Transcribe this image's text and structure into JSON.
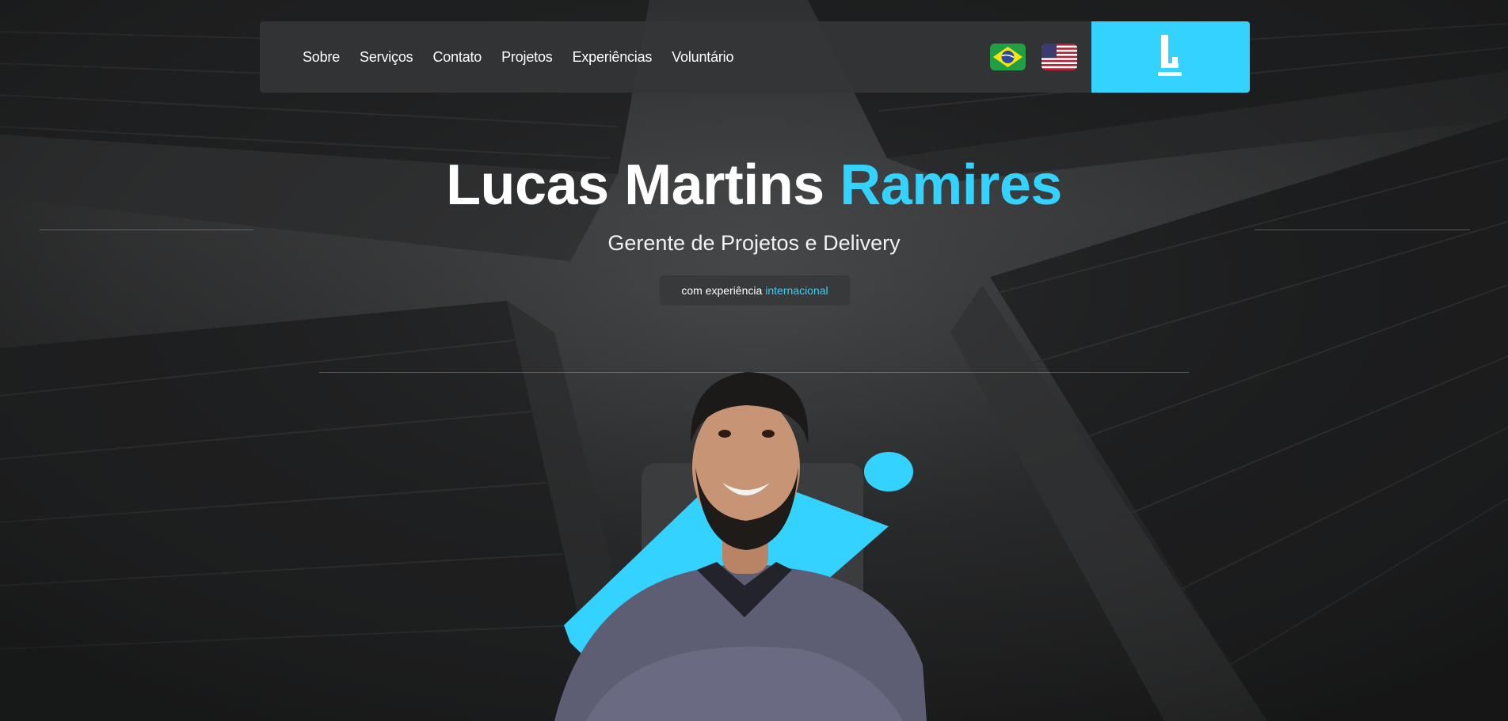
{
  "nav": {
    "links": [
      "Sobre",
      "Serviços",
      "Contato",
      "Projetos",
      "Experiências",
      "Voluntário"
    ],
    "flags": [
      {
        "name": "brazil-flag-icon"
      },
      {
        "name": "usa-flag-icon"
      }
    ]
  },
  "hero": {
    "name_first": "Lucas Martins",
    "name_last": "Ramires",
    "subtitle": "Gerente de Projetos e Delivery",
    "badge_text": "com experiência",
    "badge_accent": "internacional"
  },
  "colors": {
    "accent": "#33d2ff",
    "nav_bg": "#343536",
    "page_bg": "#2a2b2c"
  }
}
